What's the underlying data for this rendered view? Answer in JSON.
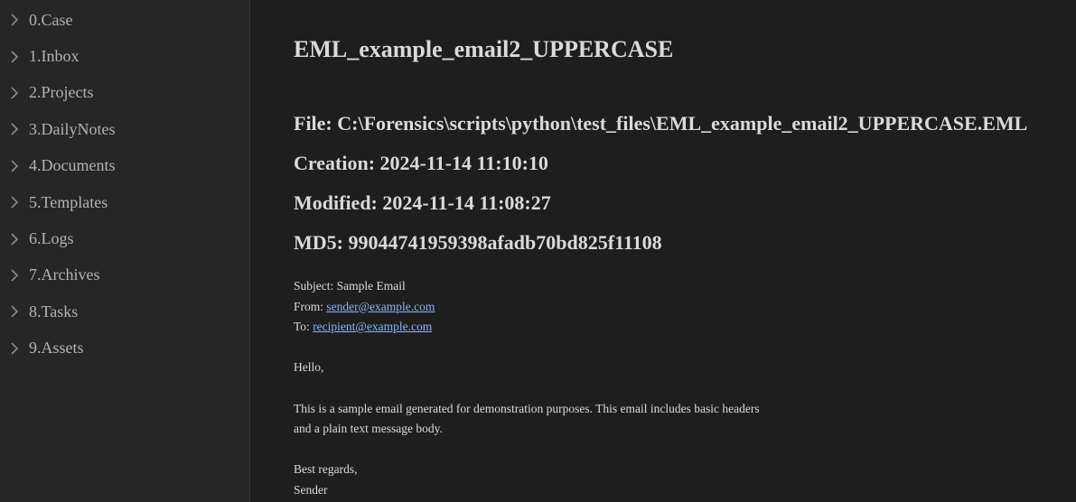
{
  "sidebar": {
    "items": [
      {
        "label": "0.Case"
      },
      {
        "label": "1.Inbox"
      },
      {
        "label": "2.Projects"
      },
      {
        "label": "3.DailyNotes"
      },
      {
        "label": "4.Documents"
      },
      {
        "label": "5.Templates"
      },
      {
        "label": "6.Logs"
      },
      {
        "label": "7.Archives"
      },
      {
        "label": "8.Tasks"
      },
      {
        "label": "9.Assets"
      }
    ],
    "icon": "chevron-right-icon"
  },
  "document": {
    "title": "EML_example_email2_UPPERCASE",
    "file": "File: C:\\Forensics\\scripts\\python\\test_files\\EML_example_email2_UPPERCASE.EML",
    "creation": "Creation: 2024-11-14 11:10:10",
    "modified": "Modified: 2024-11-14 11:08:27",
    "md5": "MD5: 99044741959398afadb70bd825f11108"
  },
  "email": {
    "subject": "Subject: Sample Email",
    "from_label": "From: ",
    "from_address": "sender@example.com",
    "to_label": "To: ",
    "to_address": "recipient@example.com",
    "greeting": "Hello,",
    "body_line1": "This is a sample email generated for demonstration purposes. This email includes basic headers",
    "body_line2": "and a plain text message body.",
    "closing": "Best regards,",
    "signature": "Sender"
  },
  "colors": {
    "background": "#1e1e1e",
    "sidebar": "#262626",
    "text": "#dadada",
    "link": "#8ab4f8"
  }
}
